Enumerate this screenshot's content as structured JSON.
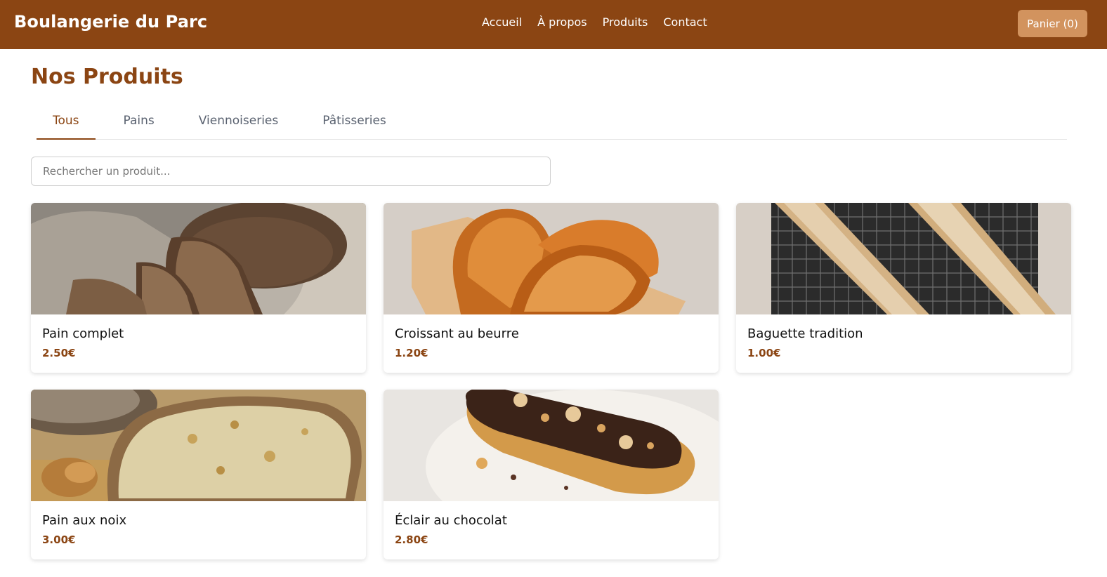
{
  "colors": {
    "brand": "#8B4513",
    "cart_button": "#D2935E",
    "title": "#8B4513",
    "price": "#8B4513"
  },
  "header": {
    "brand": "Boulangerie du Parc",
    "nav": [
      "Accueil",
      "À propos",
      "Produits",
      "Contact"
    ],
    "cart_label": "Panier (0)"
  },
  "main": {
    "title": "Nos Produits",
    "tabs": [
      {
        "label": "Tous",
        "active": true
      },
      {
        "label": "Pains",
        "active": false
      },
      {
        "label": "Viennoiseries",
        "active": false
      },
      {
        "label": "Pâtisseries",
        "active": false
      }
    ],
    "search_placeholder": "Rechercher un produit...",
    "products": [
      {
        "name": "Pain complet",
        "price": "2.50€",
        "image": "whole-wheat-bread-photo"
      },
      {
        "name": "Croissant au beurre",
        "price": "1.20€",
        "image": "croissant-photo"
      },
      {
        "name": "Baguette tradition",
        "price": "1.00€",
        "image": "baguette-photo"
      },
      {
        "name": "Pain aux noix",
        "price": "3.00€",
        "image": "walnut-bread-photo"
      },
      {
        "name": "Éclair au chocolat",
        "price": "2.80€",
        "image": "chocolate-eclair-photo"
      }
    ]
  }
}
